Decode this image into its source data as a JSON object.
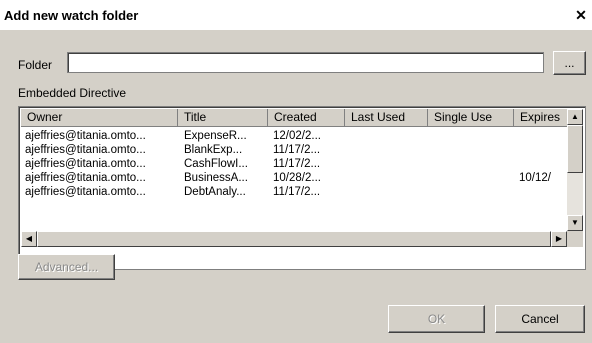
{
  "dialog": {
    "title": "Add new watch folder",
    "close_glyph": "✕"
  },
  "folder": {
    "label": "Folder",
    "value": "",
    "browse_label": "..."
  },
  "directive": {
    "label": "Embedded Directive",
    "columns": [
      "Owner",
      "Title",
      "Created",
      "Last Used",
      "Single Use",
      "Expires"
    ],
    "rows": [
      {
        "owner": "ajeffries@titania.omto...",
        "title": "ExpenseR...",
        "created": "12/02/2...",
        "last_used": "",
        "single_use": "",
        "expires": ""
      },
      {
        "owner": "ajeffries@titania.omto...",
        "title": "BlankExp...",
        "created": "11/17/2...",
        "last_used": "",
        "single_use": "",
        "expires": ""
      },
      {
        "owner": "ajeffries@titania.omto...",
        "title": "CashFlowI...",
        "created": "11/17/2...",
        "last_used": "",
        "single_use": "",
        "expires": ""
      },
      {
        "owner": "ajeffries@titania.omto...",
        "title": "BusinessA...",
        "created": "10/28/2...",
        "last_used": "",
        "single_use": "",
        "expires": "10/12/"
      },
      {
        "owner": "ajeffries@titania.omto...",
        "title": "DebtAnaly...",
        "created": "11/17/2...",
        "last_used": "",
        "single_use": "",
        "expires": ""
      }
    ]
  },
  "buttons": {
    "advanced": "Advanced...",
    "ok": "OK",
    "cancel": "Cancel"
  },
  "icons": {
    "scroll_up": "arrow-up-icon",
    "scroll_down": "arrow-down-icon",
    "scroll_left": "arrow-left-icon",
    "scroll_right": "arrow-right-icon"
  }
}
